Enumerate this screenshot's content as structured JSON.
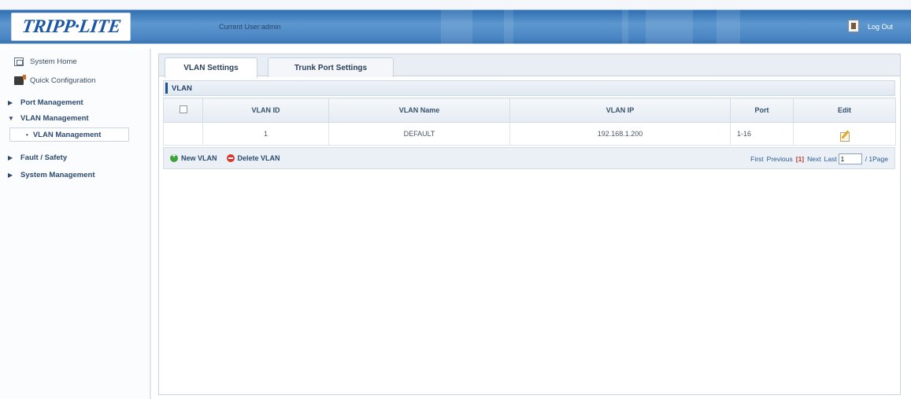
{
  "header": {
    "logo_text": "TRIPP·LITE",
    "current_user": "Current User:admin",
    "logout_label": "Log Out"
  },
  "sidebar": {
    "items": [
      {
        "label": "System Home"
      },
      {
        "label": "Quick Configuration"
      },
      {
        "label": "Port Management"
      },
      {
        "label": "VLAN Management"
      },
      {
        "label": "VLAN Management"
      },
      {
        "label": "Fault / Safety"
      },
      {
        "label": "System Management"
      }
    ]
  },
  "tabs": [
    {
      "label": "VLAN Settings",
      "active": true
    },
    {
      "label": "Trunk Port Settings",
      "active": false
    }
  ],
  "section_title": "VLAN",
  "table": {
    "headers": [
      "VLAN ID",
      "VLAN Name",
      "VLAN IP",
      "Port",
      "Edit"
    ],
    "rows": [
      {
        "vlan_id": "1",
        "vlan_name": "DEFAULT",
        "vlan_ip": "192.168.1.200",
        "port": "1-16"
      }
    ]
  },
  "actions": {
    "new_vlan": "New VLAN",
    "delete_vlan": "Delete VLAN"
  },
  "pager": {
    "first": "First",
    "previous": "Previous",
    "current": "[1]",
    "next": "Next",
    "last": "Last",
    "page_value": "1",
    "suffix": "/ 1Page"
  },
  "colors": {
    "header_blue": "#3a75b3",
    "nav_text": "#2c4a72",
    "new_icon": "#3ea23a",
    "delete_icon": "#d9372b",
    "current_page": "#c0392b"
  }
}
